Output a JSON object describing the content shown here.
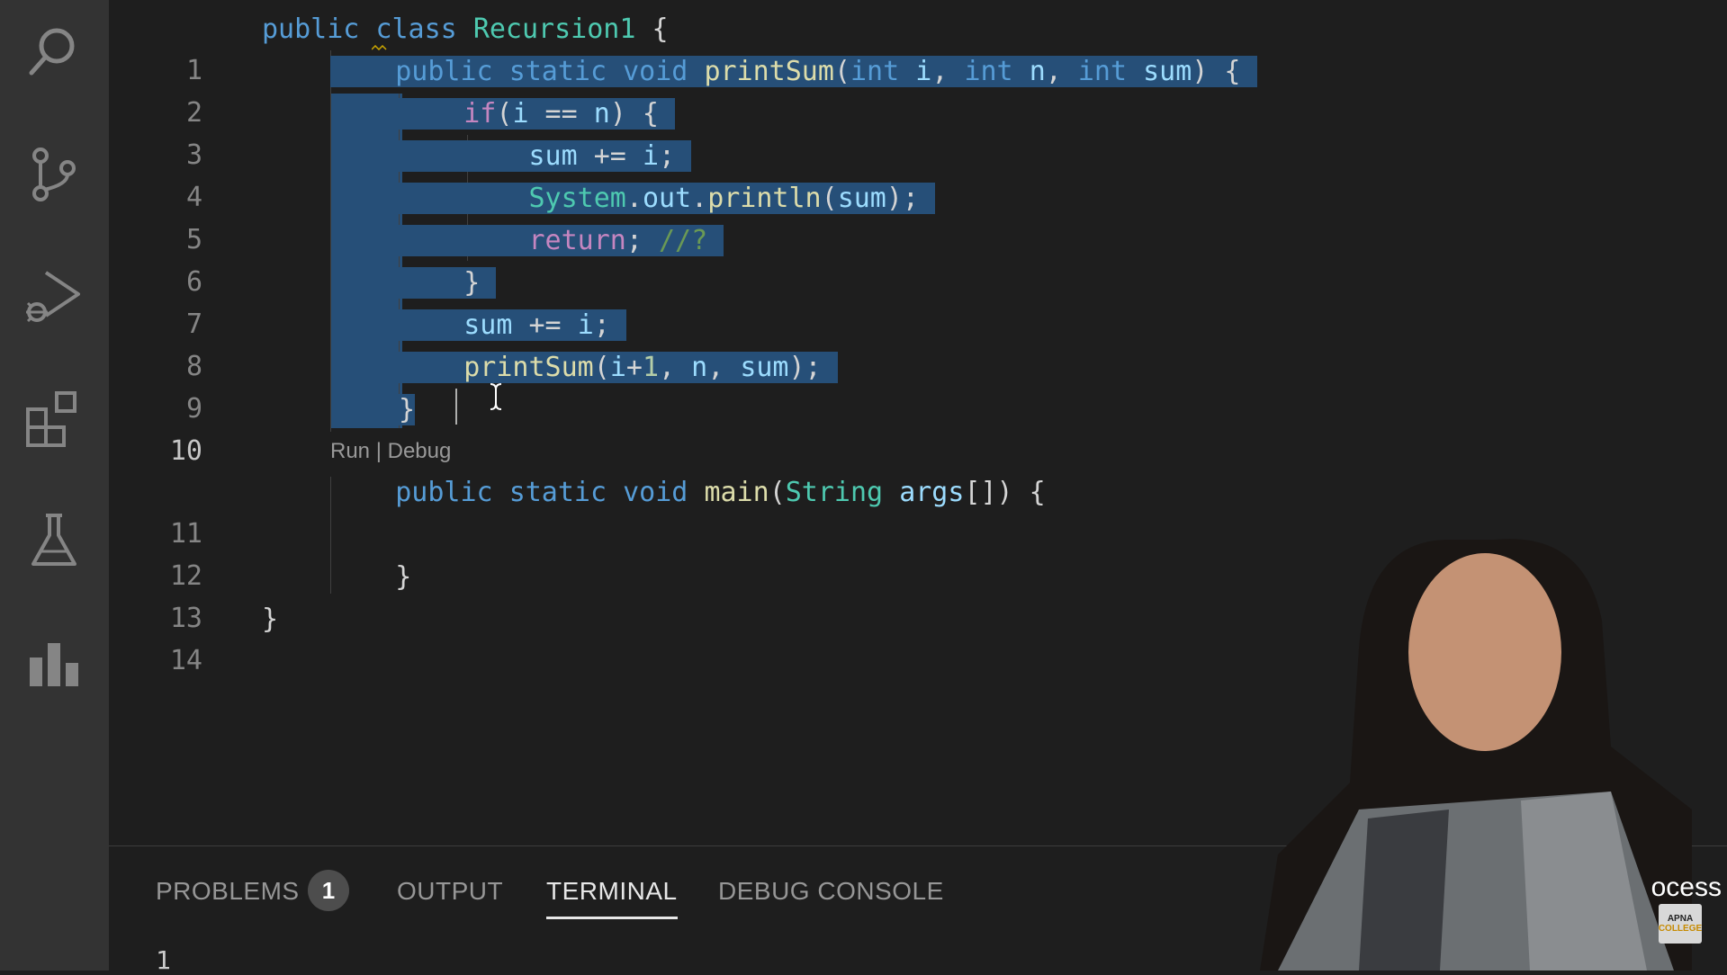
{
  "activity_bar": {
    "icons": [
      "search-icon",
      "source-control-icon",
      "run-debug-icon",
      "extensions-icon",
      "testing-icon",
      "chart-icon"
    ]
  },
  "editor": {
    "lines": [
      {
        "n": "1"
      },
      {
        "n": "2"
      },
      {
        "n": "3"
      },
      {
        "n": "4"
      },
      {
        "n": "5"
      },
      {
        "n": "6"
      },
      {
        "n": "7"
      },
      {
        "n": "8"
      },
      {
        "n": "9"
      },
      {
        "n": "10"
      },
      {
        "n": "11"
      },
      {
        "n": "12"
      },
      {
        "n": "13"
      },
      {
        "n": "14"
      }
    ],
    "codelens": {
      "run": "Run",
      "separator": " | ",
      "debug": "Debug"
    },
    "code": {
      "l1": {
        "kw1": "public",
        "kw2": "class",
        "name": "Recursion1",
        "rest": " {"
      },
      "l2": {
        "kw1": "public",
        "kw2": "static",
        "kw3": "void",
        "fn": "printSum",
        "p1t": "int",
        "p1": "i",
        "p2t": "int",
        "p2": "n",
        "p3t": "int",
        "p3": "sum",
        "rest": ") {"
      },
      "l3": {
        "kw": "if",
        "a": "i",
        "op": " == ",
        "b": "n",
        "rest": ") {"
      },
      "l4": {
        "v": "sum",
        "op": " += ",
        "v2": "i",
        "end": ";"
      },
      "l5": {
        "cls": "System",
        "field": "out",
        "fn": "println",
        "arg": "sum",
        "end": ");"
      },
      "l6": {
        "kw": "return",
        "end": "; ",
        "comment": "//?"
      },
      "l7": {
        "brace": "}"
      },
      "l8": {
        "v": "sum",
        "op": " += ",
        "v2": "i",
        "end": ";"
      },
      "l9": {
        "fn": "printSum",
        "a": "i",
        "plus": "+",
        "one": "1",
        "b": "n",
        "c": "sum",
        "end": ");"
      },
      "l10": {
        "brace": "}"
      },
      "l11": {
        "kw1": "public",
        "kw2": "static",
        "kw3": "void",
        "fn": "main",
        "ty": "String",
        "arg": "args",
        "rest": "[]) {"
      },
      "l13": {
        "brace": "}"
      },
      "l14": {
        "brace": "}"
      }
    }
  },
  "panel": {
    "tabs": {
      "problems": "PROBLEMS",
      "problems_count": "1",
      "output": "OUTPUT",
      "terminal": "TERMINAL",
      "debug_console": "DEBUG CONSOLE"
    },
    "active_tab": "TERMINAL",
    "terminal_output": "1"
  },
  "overlay": {
    "partial_text": "ocess",
    "logo_line1": "APNA",
    "logo_line2": "COLLEGE"
  },
  "colors": {
    "selection": "#264f78",
    "keyword": "#569cd6",
    "type": "#4ec9b0",
    "function": "#dcdcaa",
    "variable": "#9cdcfe",
    "control": "#c586c0",
    "comment": "#6a9955"
  }
}
